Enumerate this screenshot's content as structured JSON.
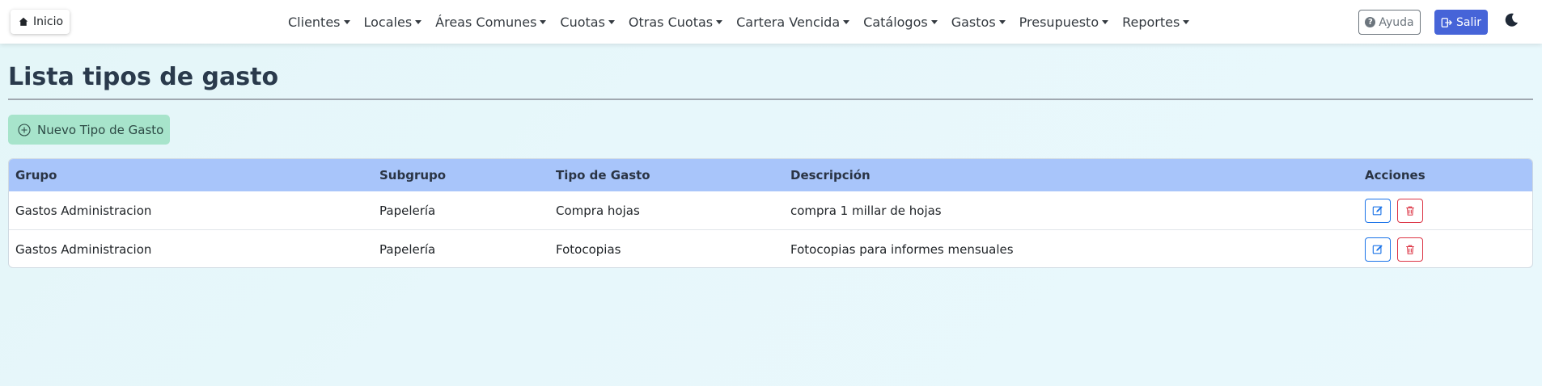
{
  "nav": {
    "home_label": "Inicio",
    "menu": [
      "Clientes",
      "Locales",
      "Áreas Comunes",
      "Cuotas",
      "Otras Cuotas",
      "Cartera Vencida",
      "Catálogos",
      "Gastos",
      "Presupuesto",
      "Reportes"
    ],
    "help_label": "Ayuda",
    "logout_label": "Salir"
  },
  "page": {
    "title": "Lista tipos de gasto",
    "new_button_label": "Nuevo Tipo de Gasto"
  },
  "table": {
    "headers": {
      "grupo": "Grupo",
      "subgrupo": "Subgrupo",
      "tipo": "Tipo de Gasto",
      "descripcion": "Descripción",
      "acciones": "Acciones"
    },
    "rows": [
      {
        "grupo": "Gastos Administracion",
        "subgrupo": "Papelería",
        "tipo": "Compra hojas",
        "descripcion": "compra 1 millar de hojas"
      },
      {
        "grupo": "Gastos Administracion",
        "subgrupo": "Papelería",
        "tipo": "Fotocopias",
        "descripcion": "Fotocopias para informes mensuales"
      }
    ]
  },
  "colors": {
    "accent": "#4664d8",
    "new_button_bg": "#a7e4cb",
    "table_header_bg": "#a8c5fa",
    "edit": "#1a73e8",
    "delete": "#dc3545"
  },
  "icons": {
    "home": "home-icon",
    "help": "question-circle-icon",
    "logout": "logout-icon",
    "theme": "moon-icon",
    "new": "plus-circle-icon",
    "edit": "edit-icon",
    "delete": "trash-icon"
  }
}
